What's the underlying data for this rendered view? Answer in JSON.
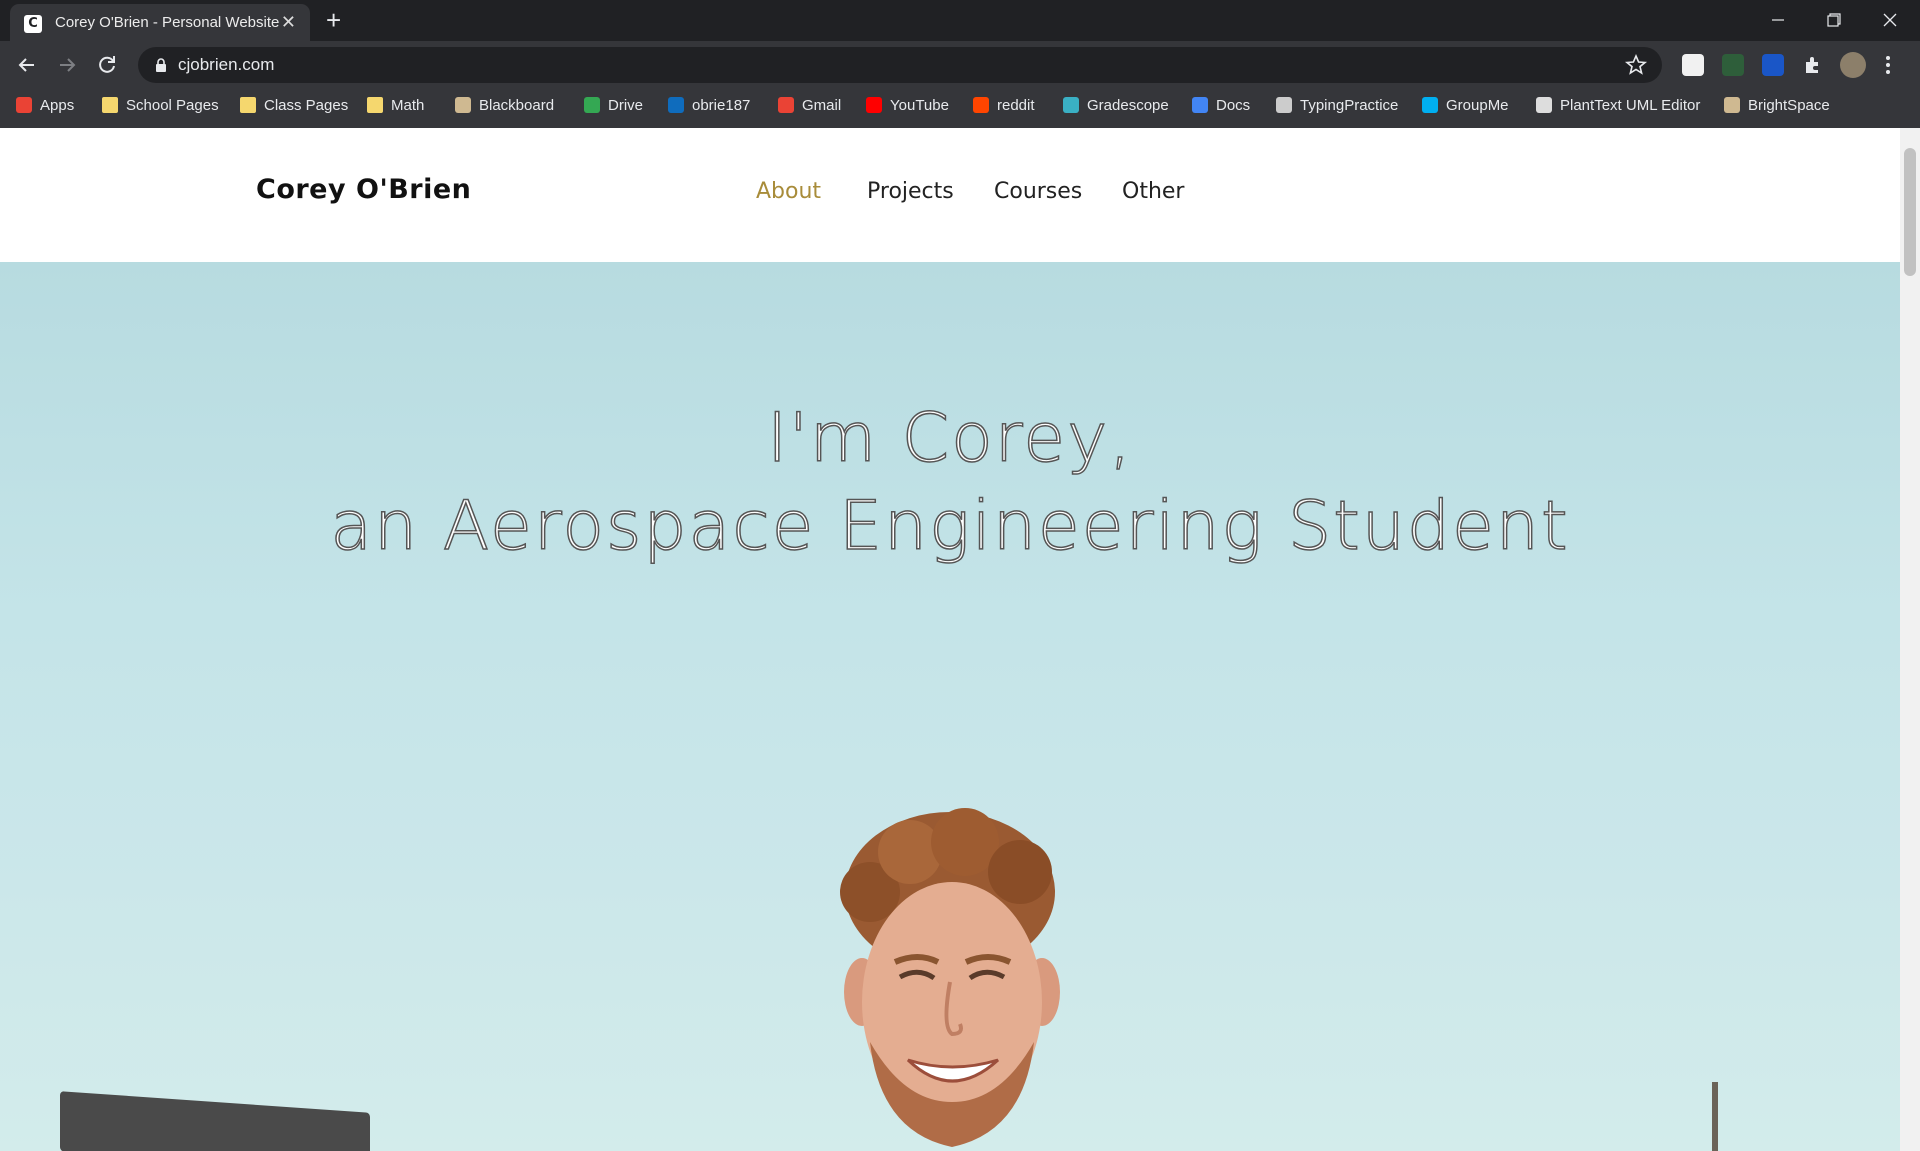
{
  "browser": {
    "tab_title": "Corey O'Brien - Personal Website",
    "favicon_letter": "C",
    "url": "cjobrien.com",
    "extension_badge": "1"
  },
  "bookmarks": [
    {
      "label": "Apps",
      "icon": "apps-grid-icon",
      "color": "#ea4335"
    },
    {
      "label": "School Pages",
      "icon": "folder-icon",
      "color": "#f5d76e"
    },
    {
      "label": "Class Pages",
      "icon": "folder-icon",
      "color": "#f5d76e"
    },
    {
      "label": "Math",
      "icon": "folder-icon",
      "color": "#f5d76e"
    },
    {
      "label": "Blackboard",
      "icon": "purdue-icon",
      "color": "#cfb991"
    },
    {
      "label": "Drive",
      "icon": "drive-icon",
      "color": "#34a853"
    },
    {
      "label": "obrie187",
      "icon": "outlook-icon",
      "color": "#0f6cbd"
    },
    {
      "label": "Gmail",
      "icon": "gmail-icon",
      "color": "#ea4335"
    },
    {
      "label": "YouTube",
      "icon": "youtube-icon",
      "color": "#ff0000"
    },
    {
      "label": "reddit",
      "icon": "reddit-icon",
      "color": "#ff4500"
    },
    {
      "label": "Gradescope",
      "icon": "gradescope-icon",
      "color": "#3ab0c4"
    },
    {
      "label": "Docs",
      "icon": "docs-icon",
      "color": "#4285f4"
    },
    {
      "label": "TypingPractice",
      "icon": "typing-icon",
      "color": "#cccccc"
    },
    {
      "label": "GroupMe",
      "icon": "groupme-icon",
      "color": "#00aff0"
    },
    {
      "label": "PlantText UML Editor",
      "icon": "planttext-icon",
      "color": "#dddddd"
    },
    {
      "label": "BrightSpace",
      "icon": "purdue-icon",
      "color": "#cfb991"
    }
  ],
  "site": {
    "brand": "Corey O'Brien",
    "nav": [
      "About",
      "Projects",
      "Courses",
      "Other"
    ],
    "active_nav": "About",
    "accent_color": "#a88c3a"
  },
  "hero": {
    "line1": "I'm Corey,",
    "line2": "an Aerospace Engineering Student"
  }
}
